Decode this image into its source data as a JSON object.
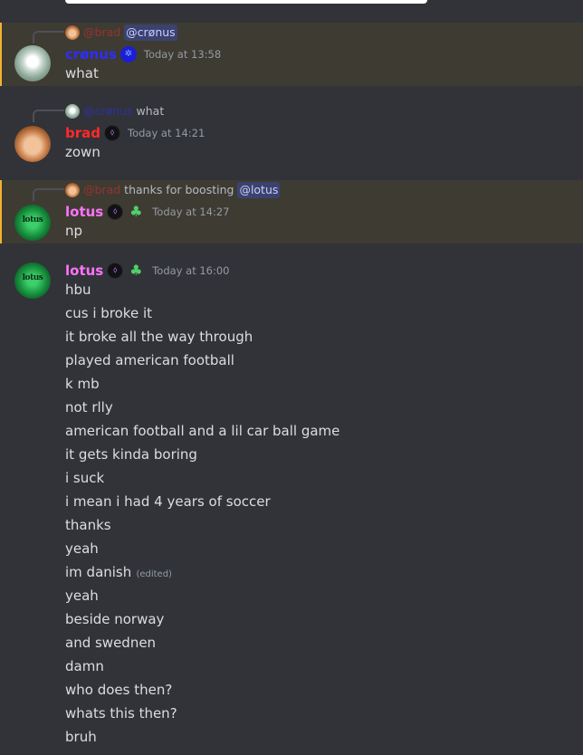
{
  "messages": [
    {
      "reply_to_user": "@brad",
      "reply_mention": "@crønus",
      "author": "crønus",
      "badge": "✲",
      "timestamp": "Today at 13:58",
      "lines": [
        "what"
      ]
    },
    {
      "reply_to_user": "@crønus",
      "reply_text": "what",
      "author": "brad",
      "badge": "⬨",
      "timestamp": "Today at 14:21",
      "lines": [
        "zown"
      ]
    },
    {
      "reply_to_user": "@brad",
      "reply_text": "thanks for boosting",
      "reply_mention": "@lotus",
      "author": "lotus",
      "badge": "⬨",
      "role_badge": "♣",
      "timestamp": "Today at 14:27",
      "lines": [
        "np"
      ]
    },
    {
      "author": "lotus",
      "badge": "⬨",
      "role_badge": "♣",
      "timestamp": "Today at 16:00",
      "lines": [
        "hbu",
        "cus i broke it",
        "it broke all the way through",
        "played american football",
        "k mb",
        "not rlly",
        "american football and a lil car ball game",
        "it gets kinda boring",
        "i suck",
        "i mean i had 4 years of soccer",
        "thanks",
        "yeah",
        "im danish",
        "yeah",
        "beside norway",
        "and swednen",
        "damn",
        "who does then?",
        "whats this then?",
        "bruh"
      ],
      "edited_label": "(edited)"
    }
  ],
  "avatar_text": {
    "lotus": "lotus"
  },
  "colors": {
    "background": "#313338",
    "highlight": "#3e3b33",
    "highlight_bar": "#f0b232",
    "cronus": "#2d2dff",
    "brad": "#ff2a2a",
    "lotus": "#ff73fa",
    "mention_bg": "#3c4270"
  }
}
